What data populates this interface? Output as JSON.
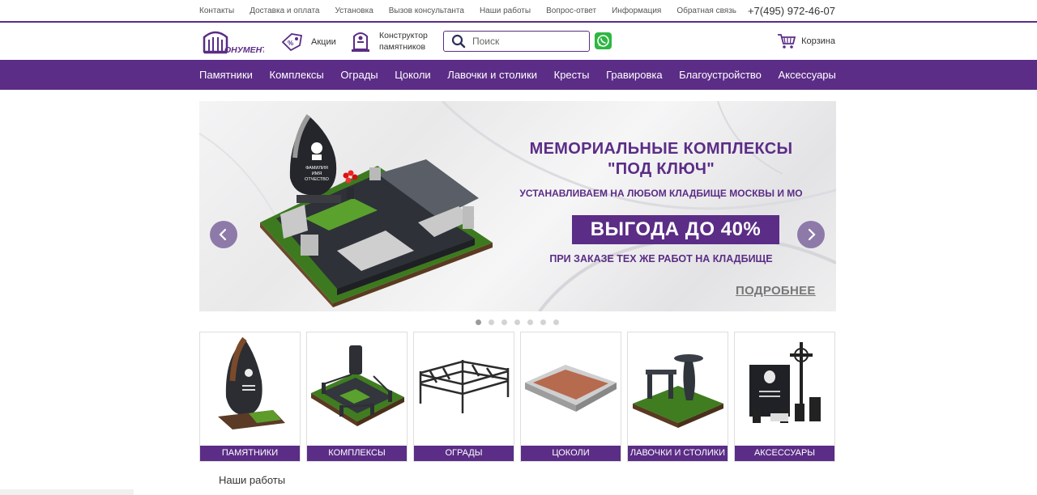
{
  "topbar": {
    "links": [
      "Контакты",
      "Доставка и оплата",
      "Установка",
      "Вызов консультанта",
      "Наши работы",
      "Вопрос-ответ",
      "Информация",
      "Обратная связь"
    ],
    "phone": "+7(495) 972-46-07"
  },
  "header": {
    "logo_text": "ОНУМЕНТ",
    "promo_label": "Акции",
    "constructor_line1": "Конструктор",
    "constructor_line2": "памятников",
    "search_placeholder": "Поиск",
    "cart_label": "Корзина"
  },
  "nav": {
    "items": [
      "Памятники",
      "Комплексы",
      "Ограды",
      "Цоколи",
      "Лавочки и столики",
      "Кресты",
      "Гравировка",
      "Благоустройство",
      "Аксессуары"
    ]
  },
  "slider": {
    "title_line1": "МЕМОРИАЛЬНЫЕ КОМПЛЕКСЫ",
    "title_line2": "\"ПОД КЛЮЧ\"",
    "subtitle": "УСТАНАВЛИВАЕМ НА ЛЮБОМ КЛАДБИЩЕ МОСКВЫ И МО",
    "badge": "ВЫГОДА ДО 40%",
    "note": "ПРИ ЗАКАЗЕ ТЕХ ЖЕ РАБОТ НА КЛАДБИЩЕ",
    "more": "ПОДРОБНЕЕ",
    "stone_text_1": "ФАМИЛИЯ",
    "stone_text_2": "ИМЯ",
    "stone_text_3": "ОТЧЕСТВО",
    "dots_total": 7,
    "active_dot": 1
  },
  "categories": [
    {
      "label": "ПАМЯТНИКИ"
    },
    {
      "label": "КОМПЛЕКСЫ"
    },
    {
      "label": "ОГРАДЫ"
    },
    {
      "label": "ЦОКОЛИ"
    },
    {
      "label": "ЛАВОЧКИ И СТОЛИКИ"
    },
    {
      "label": "АКСЕССУАРЫ"
    }
  ],
  "section_title": "Наши работы",
  "colors": {
    "brand": "#5b2d86",
    "arrow": "#8d7aa9",
    "whatsapp": "#2db742"
  }
}
